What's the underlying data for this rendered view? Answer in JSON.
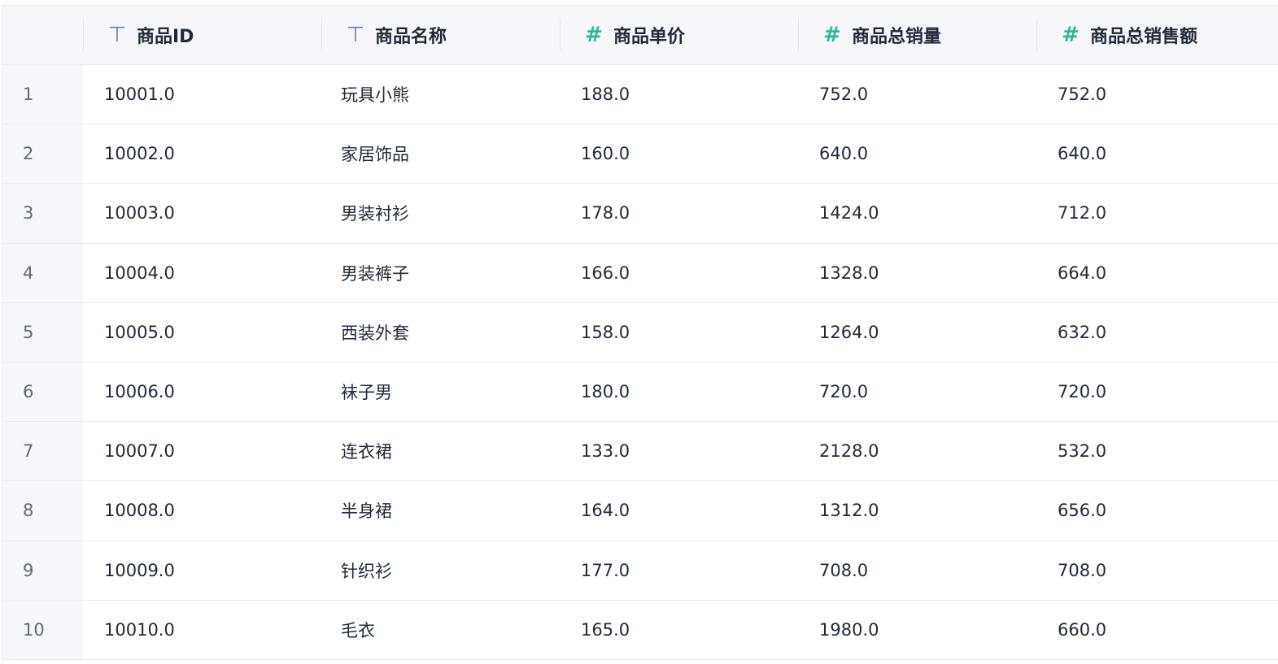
{
  "columns": [
    {
      "label": "商品ID",
      "type": "text",
      "icon": "text-type-icon",
      "glyph": "⊤",
      "color": "#5b7fd6"
    },
    {
      "label": "商品名称",
      "type": "text",
      "icon": "text-type-icon",
      "glyph": "⊤",
      "color": "#5b7fd6"
    },
    {
      "label": "商品单价",
      "type": "number",
      "icon": "number-type-icon",
      "glyph": "#",
      "color": "#2fb5a3"
    },
    {
      "label": "商品总销量",
      "type": "number",
      "icon": "number-type-icon",
      "glyph": "#",
      "color": "#2fb5a3"
    },
    {
      "label": "商品总销售额",
      "type": "number",
      "icon": "number-type-icon",
      "glyph": "#",
      "color": "#2fb5a3"
    }
  ],
  "rows": [
    {
      "index": "1",
      "cells": [
        "10001.0",
        "玩具小熊",
        "188.0",
        "752.0",
        "752.0"
      ]
    },
    {
      "index": "2",
      "cells": [
        "10002.0",
        "家居饰品",
        "160.0",
        "640.0",
        "640.0"
      ]
    },
    {
      "index": "3",
      "cells": [
        "10003.0",
        "男装衬衫",
        "178.0",
        "1424.0",
        "712.0"
      ]
    },
    {
      "index": "4",
      "cells": [
        "10004.0",
        "男装裤子",
        "166.0",
        "1328.0",
        "664.0"
      ]
    },
    {
      "index": "5",
      "cells": [
        "10005.0",
        "西装外套",
        "158.0",
        "1264.0",
        "632.0"
      ]
    },
    {
      "index": "6",
      "cells": [
        "10006.0",
        "袜子男",
        "180.0",
        "720.0",
        "720.0"
      ]
    },
    {
      "index": "7",
      "cells": [
        "10007.0",
        "连衣裙",
        "133.0",
        "2128.0",
        "532.0"
      ]
    },
    {
      "index": "8",
      "cells": [
        "10008.0",
        "半身裙",
        "164.0",
        "1312.0",
        "656.0"
      ]
    },
    {
      "index": "9",
      "cells": [
        "10009.0",
        "针织衫",
        "177.0",
        "708.0",
        "708.0"
      ]
    },
    {
      "index": "10",
      "cells": [
        "10010.0",
        "毛衣",
        "165.0",
        "1980.0",
        "660.0"
      ]
    }
  ]
}
